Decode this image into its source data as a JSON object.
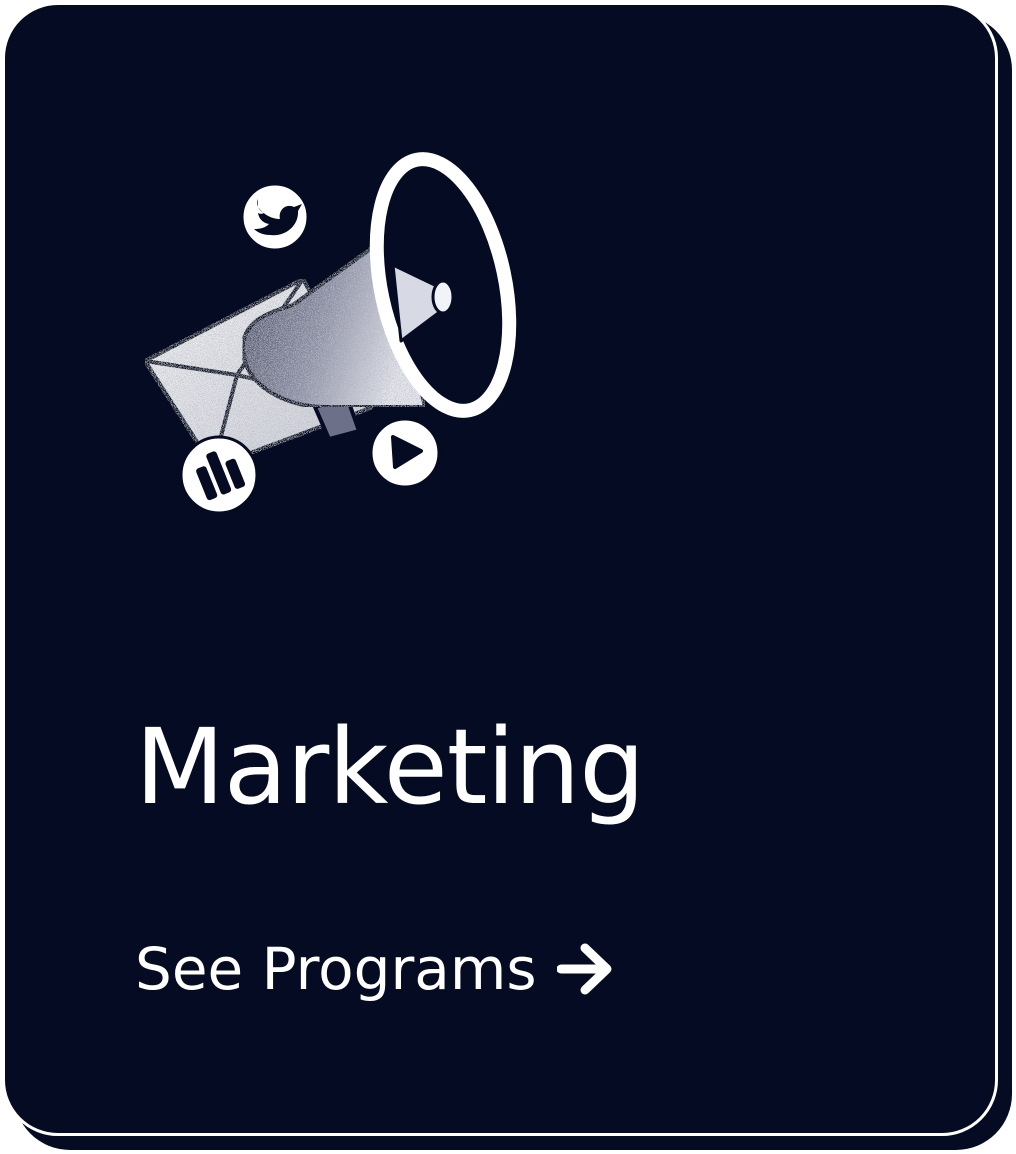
{
  "card": {
    "title": "Marketing",
    "cta_label": "See Programs",
    "cta_icon": "arrow-right-icon",
    "illustration_icon": "megaphone-illustration",
    "background_color": "#050b22",
    "text_color": "#ffffff"
  }
}
